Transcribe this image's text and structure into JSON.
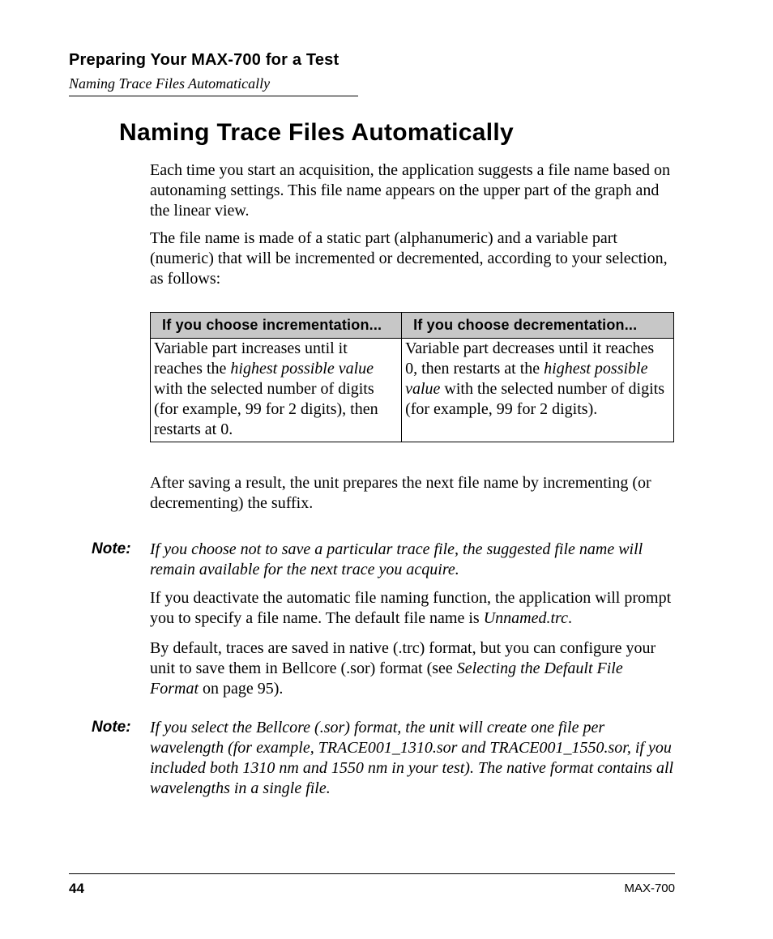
{
  "header": {
    "chapter": "Preparing Your MAX-700 for a Test",
    "section": "Naming Trace Files Automatically"
  },
  "title": "Naming Trace Files Automatically",
  "p_intro": "Each time you start an acquisition, the application suggests a file name based on autonaming settings. This file name appears on the upper part of the graph and the linear view.",
  "p_filename": "The file name is made of a static part (alphanumeric) and a variable part (numeric) that will be incremented or decremented, according to your selection, as follows:",
  "table": {
    "head_inc": "If you choose incrementation...",
    "head_dec": "If you choose decrementation...",
    "inc_a": "Variable part increases until it reaches the ",
    "inc_hi": "highest possible value",
    "inc_b": " with the selected number of digits (for example, 99 for 2 digits), then restarts at 0.",
    "dec_a": "Variable part decreases until it reaches 0, then restarts at the ",
    "dec_hi": "highest possible value",
    "dec_b": " with the selected number of digits (for example, 99 for 2 digits)."
  },
  "p_after": "After saving a result, the unit prepares the next file name by incrementing (or decrementing) the suffix.",
  "note_label": "Note:",
  "note1": "If you choose not to save a particular trace file, the suggested file name will remain available for the next trace you acquire.",
  "p_deact_a": "If you deactivate the automatic file naming function, the application will prompt you to specify a file name. The default file name is ",
  "p_deact_fname": "Unnamed.trc",
  "p_deact_b": ".",
  "p_bydef_a": "By default, traces are saved in native (.trc) format, but you can configure your unit to save them in Bellcore (.sor) format (see ",
  "p_bydef_ref": "Selecting the Default File Format",
  "p_bydef_b": " on page 95).",
  "note2": "If you select the Bellcore (.sor) format, the unit will create one file per wavelength (for example, TRACE001_1310.sor and TRACE001_1550.sor, if you included both 1310 nm and 1550 nm in your test). The native format contains all wavelengths in a single file.",
  "footer": {
    "page": "44",
    "product": "MAX-700"
  }
}
